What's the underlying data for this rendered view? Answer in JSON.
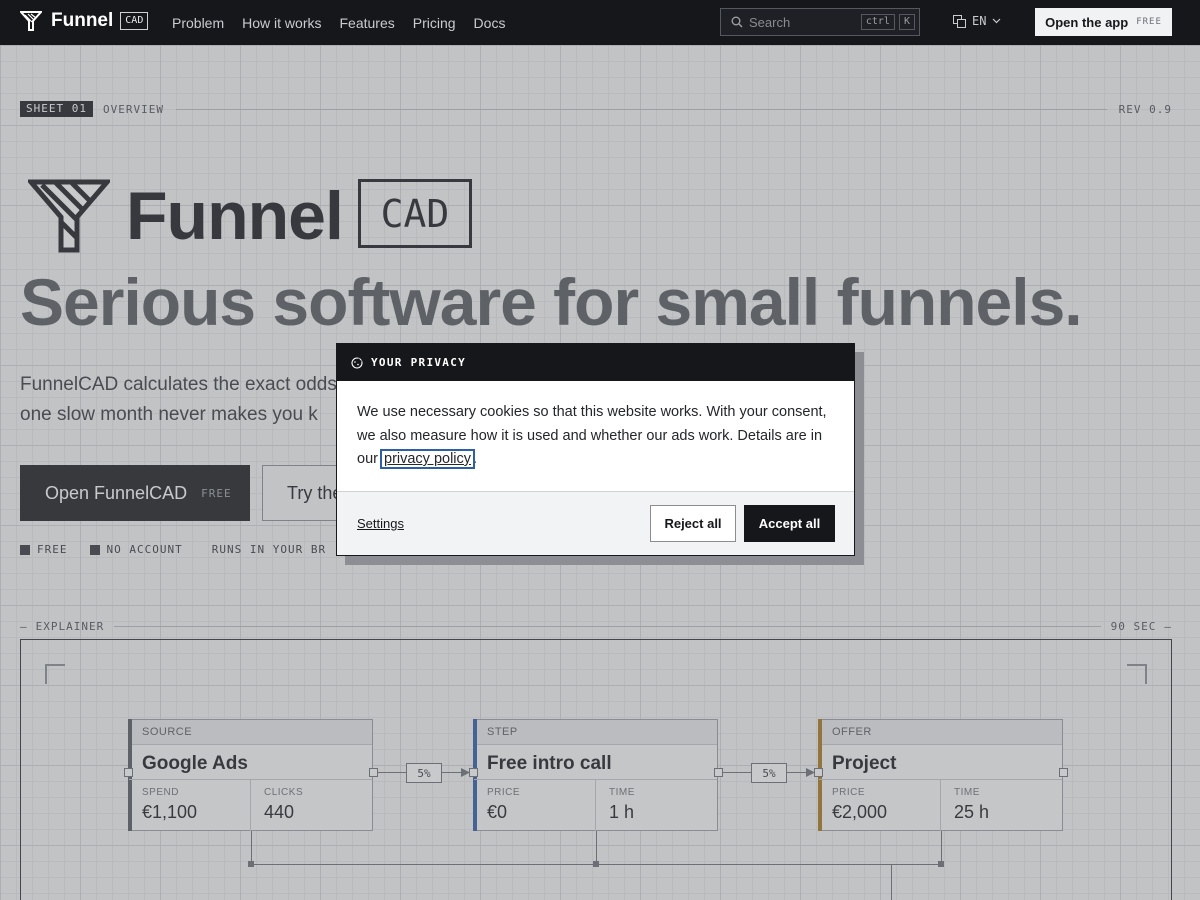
{
  "nav": {
    "brand_name": "Funnel",
    "brand_tag": "CAD",
    "links": [
      "Problem",
      "How it works",
      "Features",
      "Pricing",
      "Docs"
    ],
    "search": {
      "placeholder": "Search",
      "kbd_1": "ctrl",
      "kbd_2": "K"
    },
    "language": "EN",
    "open_app_label": "Open the app",
    "open_app_badge": "FREE"
  },
  "sheet": {
    "badge": "SHEET 01",
    "label": "OVERVIEW",
    "rev": "REV 0.9"
  },
  "hero": {
    "logo_word": "Funnel",
    "logo_tag": "CAD",
    "headline": "Serious software for small funnels.",
    "lede_line_1": "FunnelCAD calculates the exact odds",
    "lede_line_2": "one slow month never makes you k",
    "cta_primary": "Open FunnelCAD",
    "cta_primary_badge": "FREE",
    "cta_secondary": "Try the",
    "checks": [
      "FREE",
      "NO ACCOUNT",
      "RUNS IN YOUR BROWSER"
    ]
  },
  "explainer": {
    "label": "EXPLAINER",
    "duration": "90 SEC",
    "nodes": [
      {
        "kind": "SOURCE",
        "title": "Google Ads",
        "stats": [
          {
            "label": "SPEND",
            "value": "€1,100"
          },
          {
            "label": "CLICKS",
            "value": "440"
          }
        ]
      },
      {
        "kind": "STEP",
        "title": "Free intro call",
        "stats": [
          {
            "label": "PRICE",
            "value": "€0"
          },
          {
            "label": "TIME",
            "value": "1 h"
          }
        ]
      },
      {
        "kind": "OFFER",
        "title": "Project",
        "stats": [
          {
            "label": "PRICE",
            "value": "€2,000"
          },
          {
            "label": "TIME",
            "value": "25 h"
          }
        ]
      }
    ],
    "conversions": [
      "5%",
      "5%"
    ],
    "accent_colors": [
      "#55585e",
      "#2e5aa8",
      "#a8771a"
    ]
  },
  "cookie_modal": {
    "title": "YOUR PRIVACY",
    "body_before": "We use necessary cookies so that this website works. With your consent, we also measure how it is used and whether our ads work. Details are in our ",
    "policy_link": "privacy policy",
    "body_after": ".",
    "settings_label": "Settings",
    "reject_label": "Reject all",
    "accept_label": "Accept all"
  }
}
